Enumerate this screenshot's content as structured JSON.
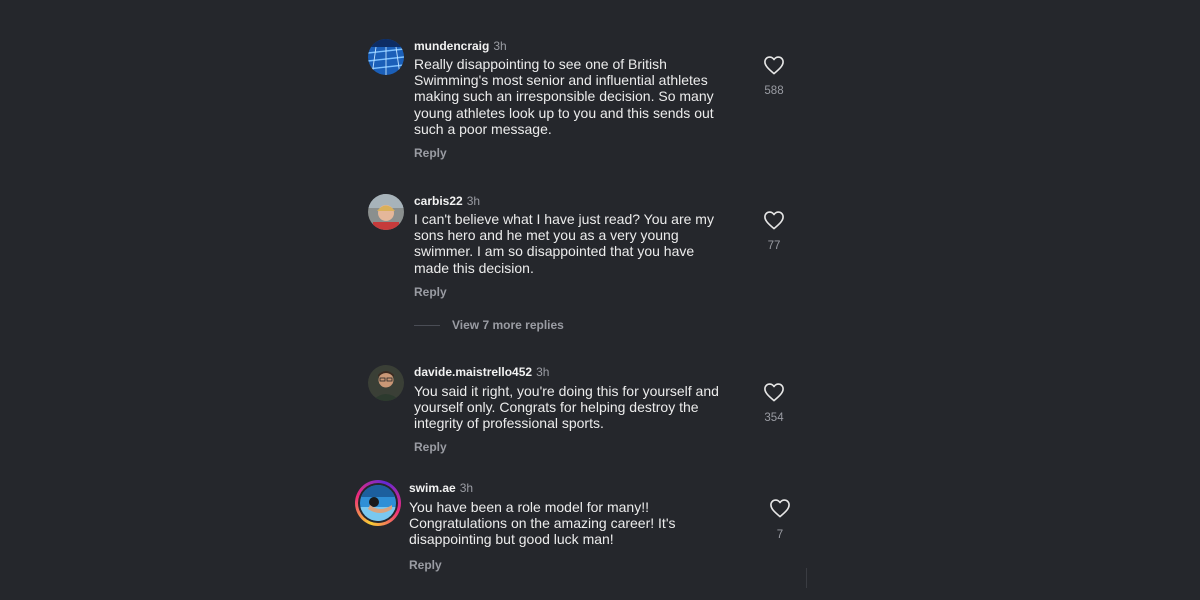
{
  "icons": {
    "like": "heart-outline-icon"
  },
  "colors": {
    "background": "#25272c",
    "primary_text": "#ececec",
    "secondary_text": "#9a9ca3",
    "story_ring": [
      "#f9ce34",
      "#ee2a7b",
      "#6228d7"
    ]
  },
  "comments": [
    {
      "username": "mundencraig",
      "time": "3h",
      "lines": [
        "Really disappointing to see one of British",
        "Swimming's most senior and influential athletes",
        "making such an irresponsible decision. So many",
        "young athletes look up to you and this sends out",
        "such a poor message."
      ],
      "reply_label": "Reply",
      "likes": "588"
    },
    {
      "username": "carbis22",
      "time": "3h",
      "lines": [
        "I can't believe what I have just read? You are my",
        "sons hero and he met you as a very young",
        "swimmer. I am so disappointed that you have",
        "made this decision."
      ],
      "reply_label": "Reply",
      "likes": "77",
      "view_replies_label": "View 7 more replies"
    },
    {
      "username": "davide.maistrello452",
      "time": "3h",
      "lines": [
        "You said it right, you're doing this for yourself and",
        "yourself only. Congrats for helping destroy the",
        "integrity of professional sports."
      ],
      "reply_label": "Reply",
      "likes": "354"
    },
    {
      "username": "swim.ae",
      "time": "3h",
      "lines": [
        "You have been a role model for many!!",
        "Congratulations on the amazing career! It's",
        "disappointing but good luck man!"
      ],
      "reply_label": "Reply",
      "likes": "7"
    }
  ]
}
